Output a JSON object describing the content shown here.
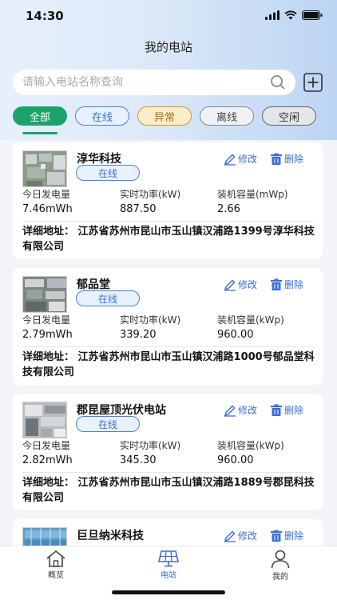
{
  "status_bar": {
    "time": "14:30"
  },
  "header": {
    "title": "我的电站"
  },
  "search": {
    "placeholder": "请输入电站名称查询"
  },
  "filters": [
    "全部",
    "在线",
    "异常",
    "离线",
    "空闲"
  ],
  "metric_labels": {
    "today": "今日发电量",
    "power": "实时功率(kW)",
    "capacity_mwp": "装机容量(mWp)",
    "capacity_kwp": "装机容量(kWp)"
  },
  "actions": {
    "edit": "修改",
    "delete": "删除"
  },
  "stations": [
    {
      "name": "淳华科技",
      "status": "在线",
      "today": "7.46mWh",
      "power": "887.50",
      "capacity_label": "装机容量(mWp)",
      "capacity": "2.66",
      "address": "详细地址：  江苏省苏州市昆山市玉山镇汉浦路1399号淳华科技有限公司"
    },
    {
      "name": "郁品堂",
      "status": "在线",
      "today": "2.79mWh",
      "power": "339.20",
      "capacity_label": "装机容量(kWp)",
      "capacity": "960.00",
      "address": "详细地址：  江苏省苏州市昆山市玉山镇汉浦路1000号郁品堂科技有限公司"
    },
    {
      "name": "郡昆屋顶光伏电站",
      "status": "在线",
      "today": "2.82mWh",
      "power": "345.30",
      "capacity_label": "装机容量(kWp)",
      "capacity": "960.00",
      "address": "详细地址：  江苏省苏州市昆山市玉山镇汉浦路1889号郡昆科技有限公司"
    },
    {
      "name": "巨旦纳米科技"
    }
  ],
  "nav": {
    "overview": "概览",
    "station": "电站",
    "mine": "我的"
  },
  "colors": {
    "accent_green": "#1aa36a",
    "accent_blue": "#3b6fd3"
  }
}
